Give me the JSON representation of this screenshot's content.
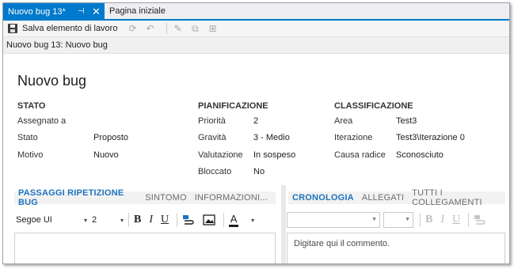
{
  "tabs": {
    "active_label": "Nuovo bug 13*",
    "pin_glyph": "⊣",
    "close_glyph": "✕",
    "other_label": "Pagina iniziale"
  },
  "toolbar": {
    "save_label": "Salva elemento di lavoro",
    "refresh_glyph": "⟳",
    "undo_glyph": "↶",
    "edit_glyph": "✎",
    "copy_glyph": "⧉",
    "template_glyph": "⊞"
  },
  "titlebar": {
    "text": "Nuovo bug 13: Nuovo bug"
  },
  "form": {
    "title": "Nuovo bug",
    "stato": {
      "header": "STATO",
      "fields": [
        {
          "label": "Assegnato a",
          "value": ""
        },
        {
          "label": "Stato",
          "value": "Proposto"
        },
        {
          "label": "Motivo",
          "value": "Nuovo"
        }
      ]
    },
    "pianificazione": {
      "header": "PIANIFICAZIONE",
      "fields": [
        {
          "label": "Priorità",
          "value": "2"
        },
        {
          "label": "Gravità",
          "value": "3 - Medio"
        },
        {
          "label": "Valutazione",
          "value": "In sospeso"
        },
        {
          "label": "Bloccato",
          "value": "No"
        }
      ]
    },
    "classificazione": {
      "header": "CLASSIFICAZIONE",
      "fields": [
        {
          "label": "Area",
          "value": "Test3"
        },
        {
          "label": "Iterazione",
          "value": "Test3\\Iterazione 0"
        },
        {
          "label": "Causa radice",
          "value": "Sconosciuto"
        }
      ]
    }
  },
  "left_tabs": [
    "PASSAGGI RIPETIZIONE BUG",
    "SINTOMO",
    "INFORMAZIONI..."
  ],
  "right_tabs": [
    "CRONOLOGIA",
    "ALLEGATI",
    "TUTTI I COLLEGAMENTI"
  ],
  "left_editor": {
    "font": "Segoe UI",
    "size": "2",
    "bold": "B",
    "italic": "I",
    "underline": "U",
    "color_letter": "A"
  },
  "right_editor": {
    "bold": "B",
    "italic": "I",
    "underline": "U",
    "placeholder": "Digitare qui il commento."
  }
}
